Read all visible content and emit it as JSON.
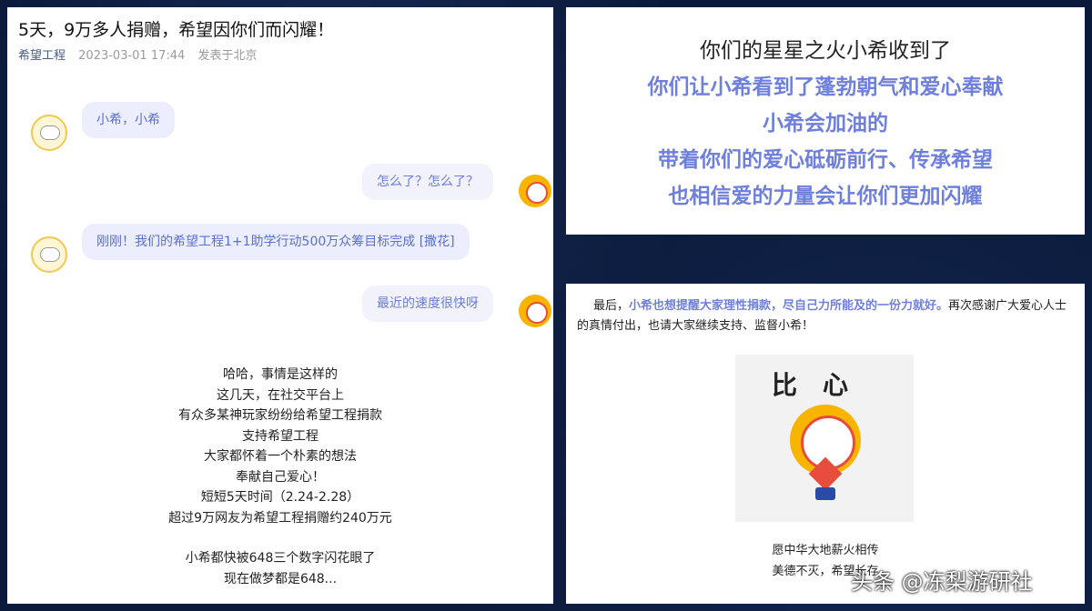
{
  "article": {
    "title": "5天，9万多人捐赠，希望因你们而闪耀！",
    "source": "希望工程",
    "time": "2023-03-01 17:44",
    "location": "发表于北京"
  },
  "chat": [
    {
      "side": "left",
      "avatar": "dog-avatar",
      "text": "小希，小希"
    },
    {
      "side": "right",
      "avatar": "sun-avatar",
      "text": "怎么了？怎么了？"
    },
    {
      "side": "left",
      "avatar": "dog-avatar",
      "text": "刚刚！我们的希望工程1+1助学行动500万众筹目标完成 [撒花]"
    },
    {
      "side": "right",
      "avatar": "sun-avatar",
      "text": "最近的速度很快呀"
    }
  ],
  "story": [
    "哈哈，事情是这样的",
    "这几天，在社交平台上",
    "有众多某神玩家纷纷给希望工程捐款",
    "支持希望工程",
    "大家都怀着一个朴素的想法",
    "奉献自己爱心！",
    "短短5天时间（2.24-2.28）",
    "超过9万网友为希望工程捐赠约240万元",
    "",
    "小希都快被648三个数字闪花眼了",
    "现在做梦都是648..."
  ],
  "top_right": {
    "line1": "你们的星星之火小希收到了",
    "line2": "你们让小希看到了蓬勃朝气和爱心奉献",
    "line3": "小希会加油的",
    "line4": "带着你们的爱心砥砺前行、传承希望",
    "line5": "也相信爱的力量会让你们更加闪耀"
  },
  "bottom_right": {
    "para_start": "最后，",
    "para_highlight": "小希也想提醒大家理性捐款，尽自己力所能及的一份力就好。",
    "para_end": "再次感谢广大爱心人士的真情付出，也请大家继续支持、监督小希！",
    "sticker_text": "比心",
    "caption1": "愿中华大地薪火相传",
    "caption2": "美德不灭，希望长存"
  },
  "watermark": "头条 @冻梨游研社",
  "colors": {
    "accent": "#6f7fdc",
    "background": "#0b1a3a"
  }
}
